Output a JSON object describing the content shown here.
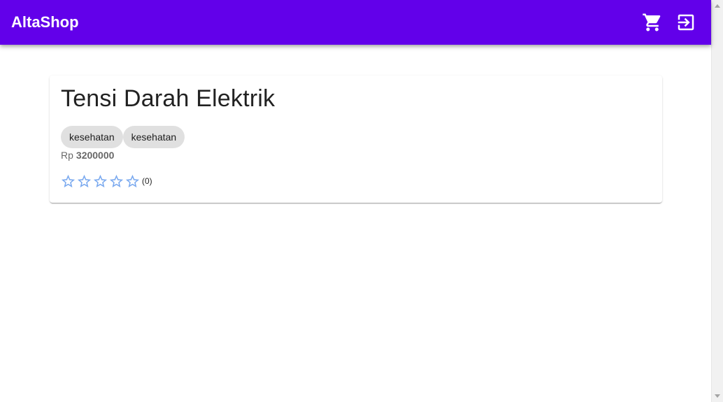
{
  "app": {
    "title": "AltaShop"
  },
  "toolbar": {
    "cart_icon": "cart-icon",
    "login_icon": "login-icon"
  },
  "product": {
    "name": "Tensi Darah Elektrik",
    "categories": [
      "kesehatan",
      "kesehatan"
    ],
    "price_currency": "Rp",
    "price_value": "3200000",
    "rating": {
      "value": 0,
      "max": 5,
      "count_label": "(0)"
    }
  },
  "colors": {
    "app_bar": "#6200ea",
    "star": "#7aa9ef",
    "chip": "#e0e0e0"
  }
}
